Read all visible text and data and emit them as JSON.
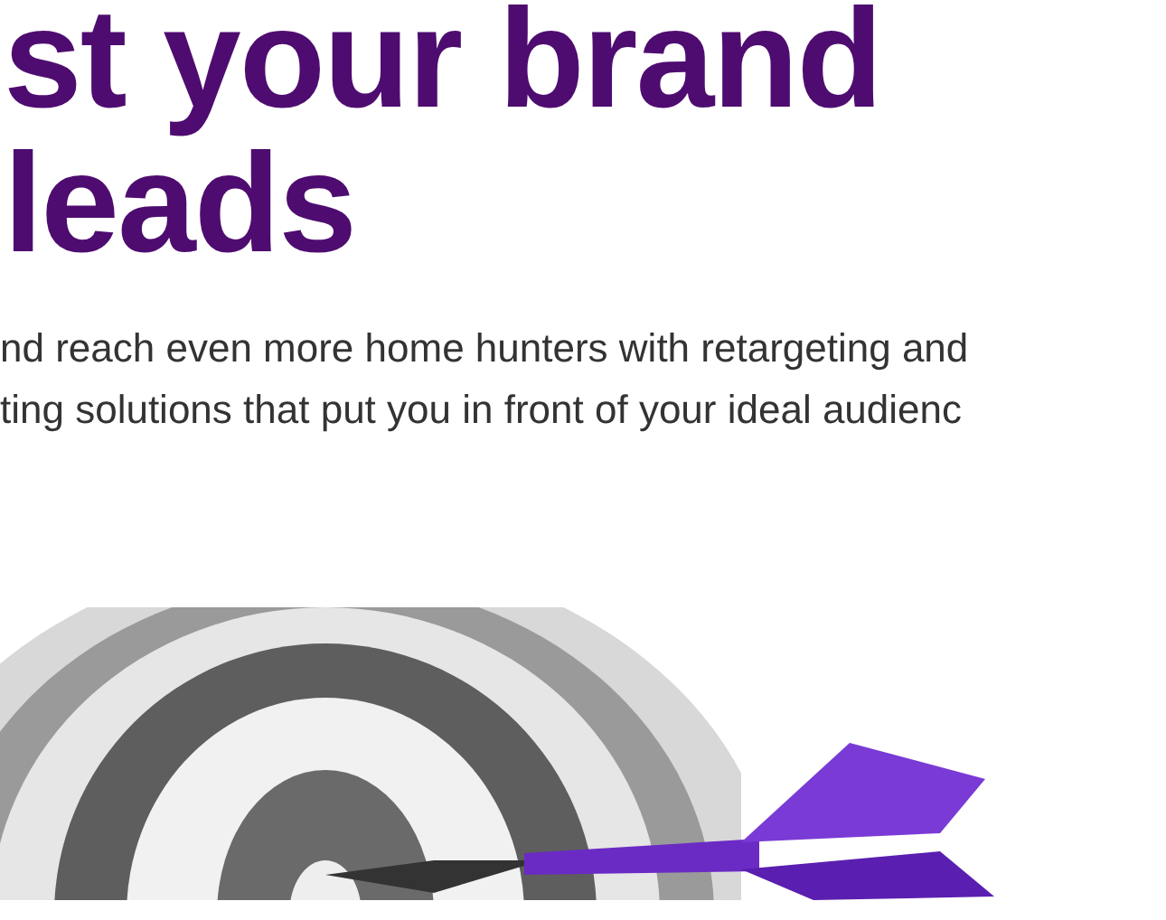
{
  "heading": {
    "lines": [
      "st your brand",
      "leads"
    ]
  },
  "paragraph": {
    "lines": [
      "nd reach even more home hunters with retargeting and",
      "ting solutions that put you in front of your ideal audienc"
    ]
  }
}
